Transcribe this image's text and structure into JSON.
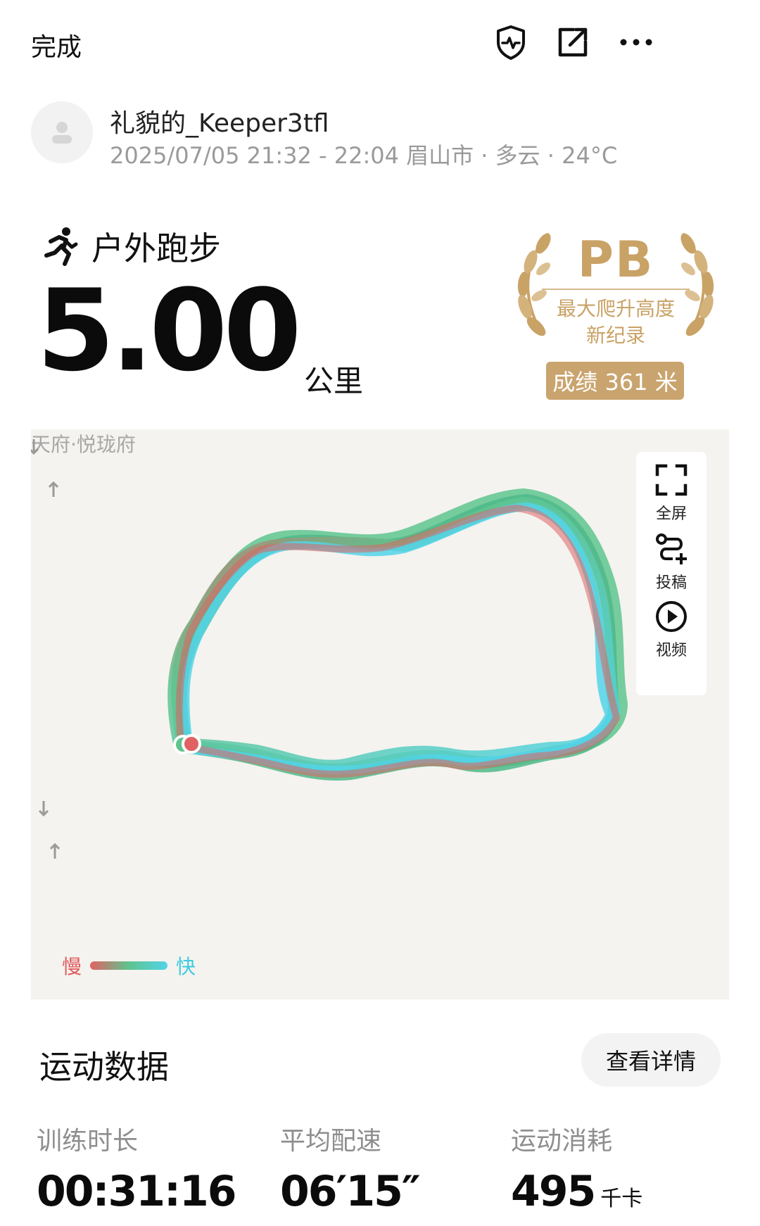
{
  "topbar": {
    "done_label": "完成",
    "icons": [
      "shield-heartbeat-icon",
      "share-icon",
      "more-icon"
    ]
  },
  "user": {
    "name": "礼貌的_Keeper3tfl",
    "meta": "2025/07/05 21:32 - 22:04 眉山市 · 多云 · 24°C"
  },
  "activity": {
    "type": "户外跑步",
    "distance": "5.00",
    "distance_unit": "公里"
  },
  "pb_badge": {
    "title": "PB",
    "desc_line1": "最大爬升高度",
    "desc_line2": "新纪录",
    "score": "成绩 361 米",
    "color": "#c9a266"
  },
  "map": {
    "place_label": "天府·悦珑府",
    "tools": [
      {
        "label": "全屏",
        "icon": "fullscreen-icon"
      },
      {
        "label": "投稿",
        "icon": "route-add-icon"
      },
      {
        "label": "视频",
        "icon": "play-icon"
      }
    ],
    "legend": {
      "slow": "慢",
      "fast": "快"
    },
    "route_colors": {
      "slow": "#e06262",
      "mid": "#5ec48e",
      "fast": "#52d4e8"
    }
  },
  "stats": {
    "section_title": "运动数据",
    "detail_button": "查看详情",
    "items": [
      {
        "label": "训练时长",
        "value": "00:31:16",
        "unit": ""
      },
      {
        "label": "平均配速",
        "value": "06′15″",
        "unit": ""
      },
      {
        "label": "运动消耗",
        "value": "495",
        "unit": "千卡"
      }
    ]
  }
}
